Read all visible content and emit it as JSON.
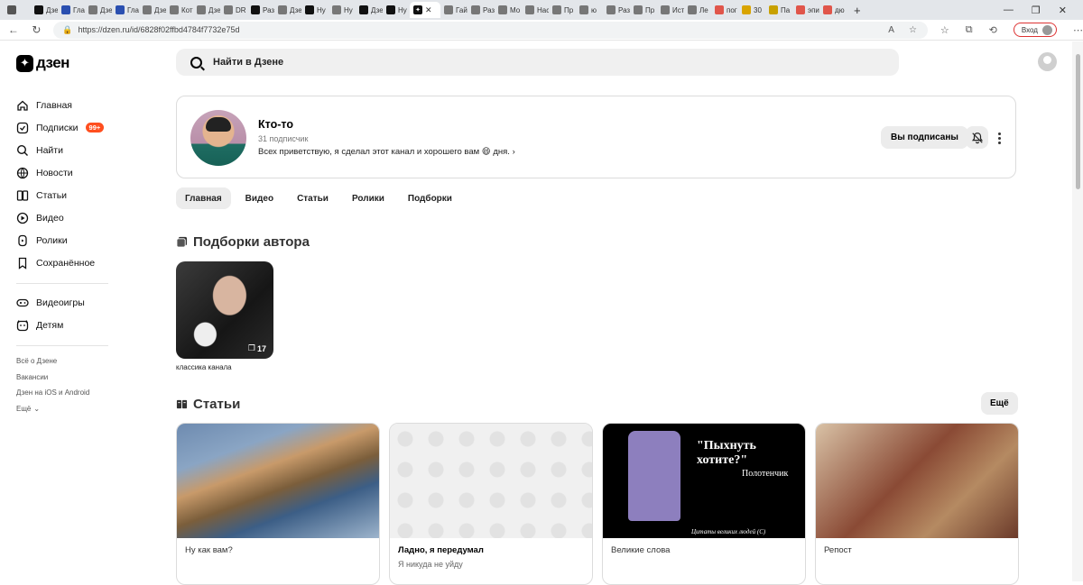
{
  "browser": {
    "tabs": [
      {
        "label": "",
        "color": "#555555"
      },
      {
        "label": "Дзе",
        "color": "#111111"
      },
      {
        "label": "Гла",
        "color": "#2a4fb0"
      },
      {
        "label": "Дзе",
        "color": "#777777"
      },
      {
        "label": "Гла",
        "color": "#2a4fb0"
      },
      {
        "label": "Дзе",
        "color": "#777777"
      },
      {
        "label": "Кот",
        "color": "#777777"
      },
      {
        "label": "Дзе",
        "color": "#777777"
      },
      {
        "label": "DR",
        "color": "#777777"
      },
      {
        "label": "Раз",
        "color": "#111111"
      },
      {
        "label": "Дзе",
        "color": "#777777"
      },
      {
        "label": "Ну",
        "color": "#111111"
      },
      {
        "label": "Ну",
        "color": "#777777"
      },
      {
        "label": "Дзе",
        "color": "#111111"
      },
      {
        "label": "Ну",
        "color": "#111111"
      }
    ],
    "tabs_after": [
      {
        "label": "Гай",
        "color": "#777777"
      },
      {
        "label": "Раз",
        "color": "#777777"
      },
      {
        "label": "Мо",
        "color": "#777777"
      },
      {
        "label": "Нас",
        "color": "#777777"
      },
      {
        "label": "Пр",
        "color": "#777777"
      },
      {
        "label": "ю",
        "color": "#777777"
      },
      {
        "label": "Раз",
        "color": "#777777"
      },
      {
        "label": "Пр",
        "color": "#777777"
      },
      {
        "label": "Ист",
        "color": "#777777"
      },
      {
        "label": "Ле",
        "color": "#777777"
      },
      {
        "label": "пог",
        "color": "#e0554a"
      },
      {
        "label": "30",
        "color": "#d9a400"
      },
      {
        "label": "Па",
        "color": "#c8a100"
      },
      {
        "label": "эпи",
        "color": "#e0554a"
      },
      {
        "label": "дю",
        "color": "#e0554a"
      }
    ],
    "url": "https://dzen.ru/id/6828f02ffbd4784f7732e75d",
    "login_label": "Вход"
  },
  "header": {
    "logo_text": "дзен",
    "search_placeholder": "Найти в Дзене"
  },
  "sidebar": {
    "items": [
      {
        "label": "Главная",
        "icon": "home-icon"
      },
      {
        "label": "Подписки",
        "icon": "subscriptions-icon",
        "badge": "99+"
      },
      {
        "label": "Найти",
        "icon": "search-icon"
      },
      {
        "label": "Новости",
        "icon": "news-icon"
      },
      {
        "label": "Статьи",
        "icon": "articles-icon"
      },
      {
        "label": "Видео",
        "icon": "video-icon"
      },
      {
        "label": "Ролики",
        "icon": "shorts-icon"
      },
      {
        "label": "Сохранённое",
        "icon": "bookmark-icon"
      }
    ],
    "items2": [
      {
        "label": "Видеоигры",
        "icon": "gamepad-icon"
      },
      {
        "label": "Детям",
        "icon": "kids-icon"
      }
    ],
    "footer": [
      "Всё о Дзене",
      "Вакансии",
      "Дзен на iOS и Android",
      "Ещё"
    ]
  },
  "channel": {
    "name": "Кто-то",
    "subscribers": "31 подписчик",
    "description": "Всех приветствую, я сделал этот канал и хорошего вам 😄 дня.",
    "subscribed_label": "Вы подписаны"
  },
  "tabs": [
    {
      "label": "Главная",
      "active": true
    },
    {
      "label": "Видео",
      "active": false
    },
    {
      "label": "Статьи",
      "active": false
    },
    {
      "label": "Ролики",
      "active": false
    },
    {
      "label": "Подборки",
      "active": false
    }
  ],
  "collections": {
    "title": "Подборки автора",
    "items": [
      {
        "caption": "классика канала",
        "count": "17"
      }
    ]
  },
  "articles": {
    "title": "Статьи",
    "more_label": "Ещё",
    "items": [
      {
        "title": "Ну как вам?",
        "subtitle": "",
        "bold": false,
        "image": "lego"
      },
      {
        "title": "Ладно, я передумал",
        "subtitle": "Я никуда не уйду",
        "bold": true,
        "image": "placeholder"
      },
      {
        "title": "Великие слова",
        "subtitle": "",
        "bold": false,
        "image": "towel",
        "image_text": [
          "\"Пыхнуть хотите?\"",
          "Полотенчик",
          "Цитаты великих людей (С)"
        ]
      },
      {
        "title": "Репост",
        "subtitle": "",
        "bold": false,
        "image": "goat"
      }
    ]
  }
}
